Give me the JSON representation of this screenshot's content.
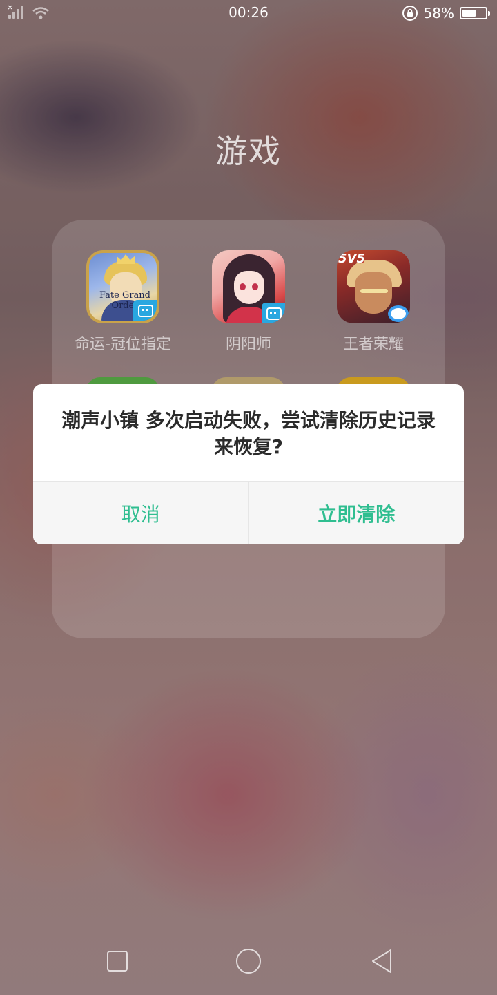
{
  "status_bar": {
    "time": "00:26",
    "battery_percent": "58%",
    "battery_level": 0.58,
    "icons": [
      "no-sim-signal-icon",
      "wifi-icon",
      "rotation-lock-icon",
      "battery-icon"
    ]
  },
  "folder": {
    "title": "游戏",
    "apps": [
      {
        "label": "命运-冠位指定",
        "icon": "fate-grand-order-icon",
        "badge_text": "Fate Grand Order"
      },
      {
        "label": "阴阳师",
        "icon": "onmyoji-icon"
      },
      {
        "label": "王者荣耀",
        "icon": "honor-of-kings-icon",
        "badge_text": "5V5"
      }
    ]
  },
  "dialog": {
    "message": "潮声小镇 多次启动失败，尝试清除历史记录来恢复?",
    "cancel_label": "取消",
    "confirm_label": "立即清除",
    "accent_color": "#2fbe90"
  },
  "nav_bar": {
    "icons": [
      "recent-apps-icon",
      "home-icon",
      "back-icon"
    ]
  }
}
